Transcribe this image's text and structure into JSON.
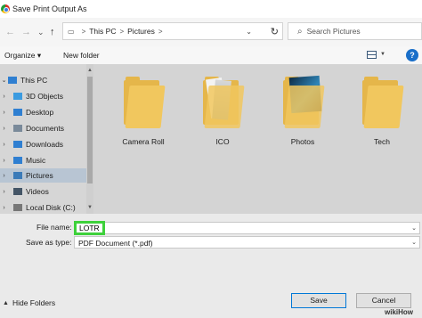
{
  "window": {
    "title": "Save Print Output As"
  },
  "nav": {
    "back": "←",
    "forward": "→",
    "recent": "⌄",
    "up": "↑"
  },
  "address": {
    "crumbs": [
      "This PC",
      "Pictures"
    ],
    "separator": ">",
    "dropdown": "⌄",
    "refresh": "↻"
  },
  "search": {
    "placeholder": "Search Pictures",
    "icon": "⌕"
  },
  "toolbar": {
    "organize": "Organize ▾",
    "new_folder": "New folder",
    "view_dd": "▼",
    "help": "?"
  },
  "sidebar": {
    "items": [
      {
        "label": "This PC",
        "icon": "computer-icon",
        "color": "#2f7fd1"
      },
      {
        "label": "3D Objects",
        "icon": "cube-icon",
        "color": "#3b9be0"
      },
      {
        "label": "Desktop",
        "icon": "desktop-icon",
        "color": "#2f7fd1"
      },
      {
        "label": "Documents",
        "icon": "documents-icon",
        "color": "#7a8a9a"
      },
      {
        "label": "Downloads",
        "icon": "download-icon",
        "color": "#2f7fd1"
      },
      {
        "label": "Music",
        "icon": "music-icon",
        "color": "#2f7fd1"
      },
      {
        "label": "Pictures",
        "icon": "pictures-icon",
        "color": "#3a7ab8"
      },
      {
        "label": "Videos",
        "icon": "videos-icon",
        "color": "#445566"
      },
      {
        "label": "Local Disk (C:)",
        "icon": "disk-icon",
        "color": "#777777"
      }
    ],
    "expand_glyph": "›"
  },
  "folders": [
    {
      "name": "Camera Roll",
      "style": "plain"
    },
    {
      "name": "ICO",
      "style": "papers"
    },
    {
      "name": "Photos",
      "style": "photo"
    },
    {
      "name": "Tech",
      "style": "plain"
    }
  ],
  "form": {
    "file_name_label": "File name:",
    "file_name_value": "LOTR",
    "save_as_type_label": "Save as type:",
    "save_as_type_value": "PDF Document (*.pdf)",
    "dropdown_glyph": "⌄"
  },
  "footer": {
    "hide_folders": "Hide Folders",
    "hide_glyph": "▲",
    "save": "Save",
    "cancel": "Cancel",
    "watermark": "wikiHow"
  },
  "colors": {
    "highlight": "#3ed13b",
    "selected": "#b8c5d3",
    "folder": "#f1c75e",
    "help": "#1a6fc9"
  }
}
